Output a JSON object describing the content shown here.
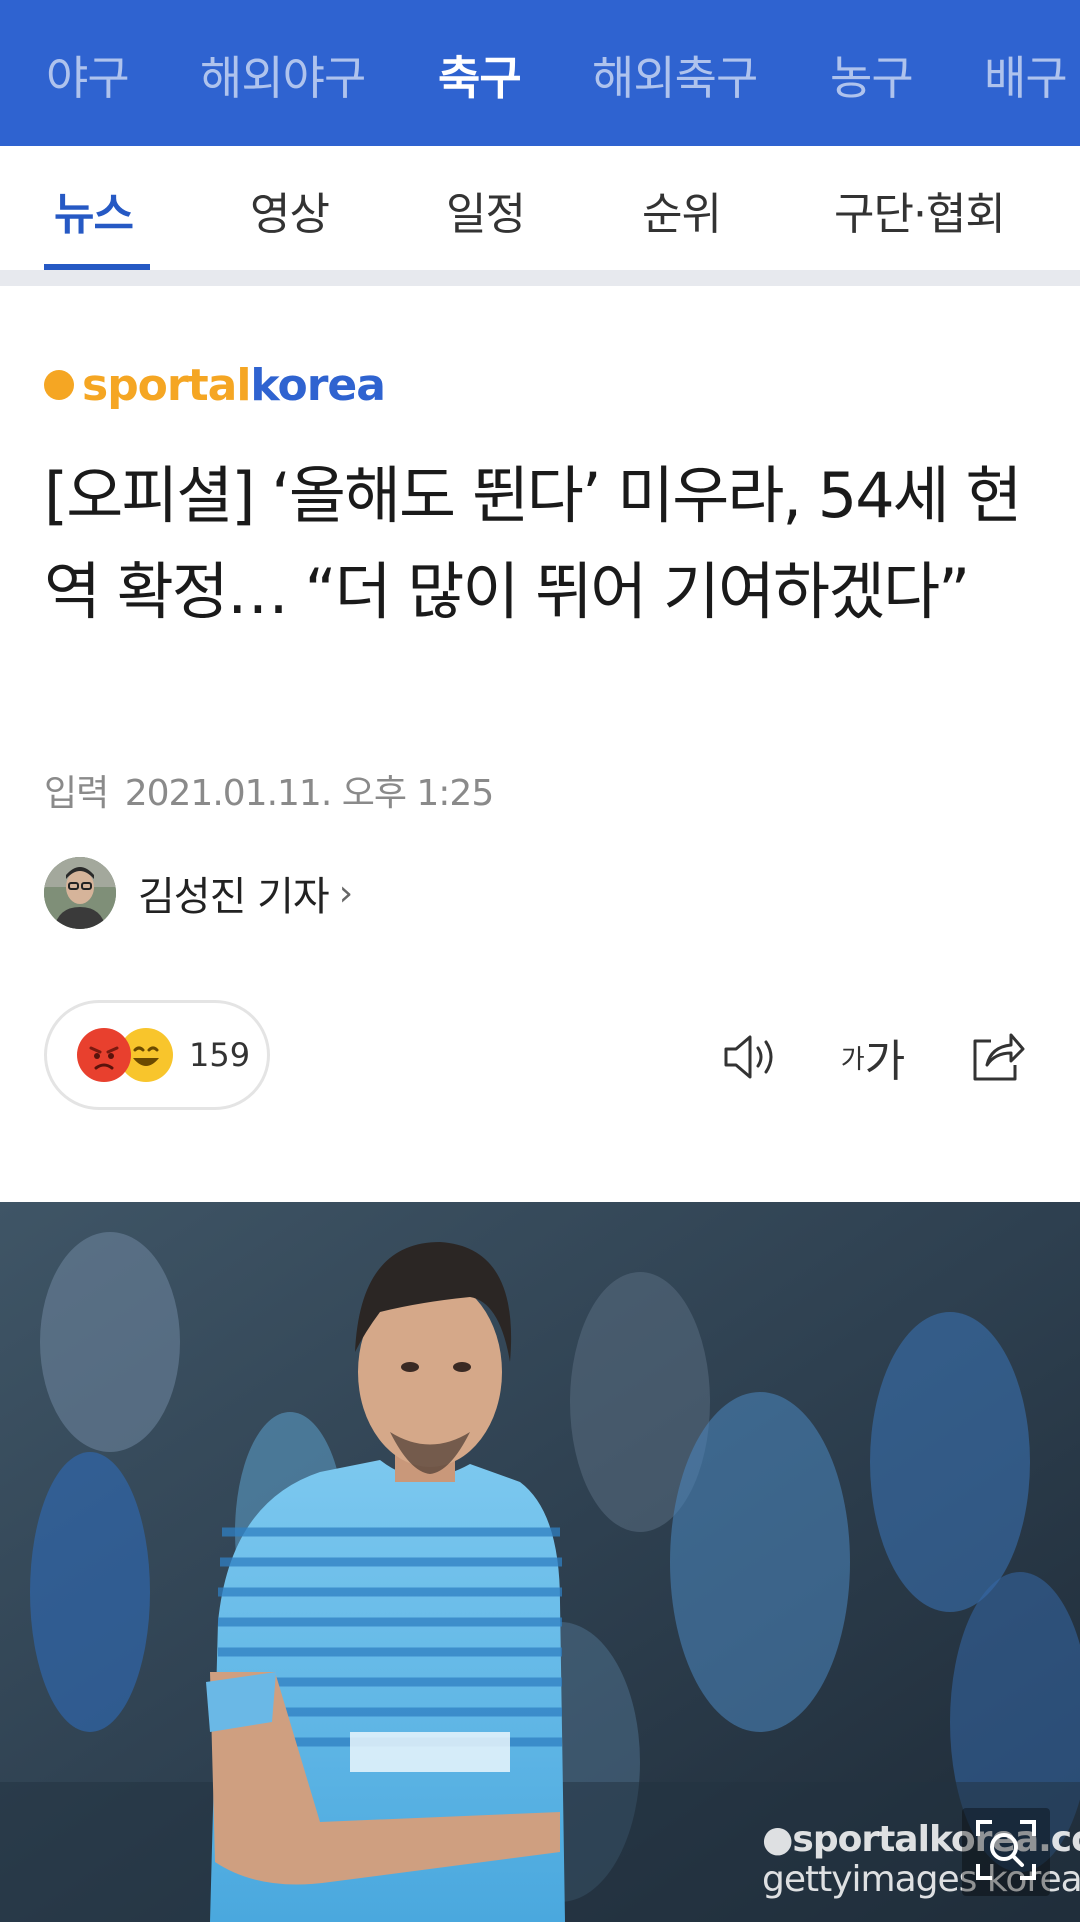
{
  "topnav": {
    "items": [
      "야구",
      "해외야구",
      "축구",
      "해외축구",
      "농구",
      "배구"
    ],
    "active_index": 2
  },
  "subtabs": {
    "items": [
      "뉴스",
      "영상",
      "일정",
      "순위",
      "구단·협회"
    ],
    "active_index": 0
  },
  "publisher": {
    "logo_part1": "sportal",
    "logo_part2": "korea"
  },
  "article": {
    "headline": "[오피셜] ‘올해도 뛴다’ 미우라, 54세 현역 확정… “더 많이 뛰어 기여하겠다”",
    "date_label": "입력",
    "date": "2021.01.11. 오후 1:25",
    "author": "김성진 기자",
    "author_chevron": "›"
  },
  "reactions": {
    "count": "159"
  },
  "font_control": {
    "small": "가",
    "large": "가"
  },
  "photo": {
    "watermark_line1": "●sportalkorea.com",
    "watermark_line2": "gettyimages korea"
  },
  "colors": {
    "brand_blue": "#2f63d0",
    "active_tab": "#2659c4",
    "logo_orange": "#f5a623"
  }
}
